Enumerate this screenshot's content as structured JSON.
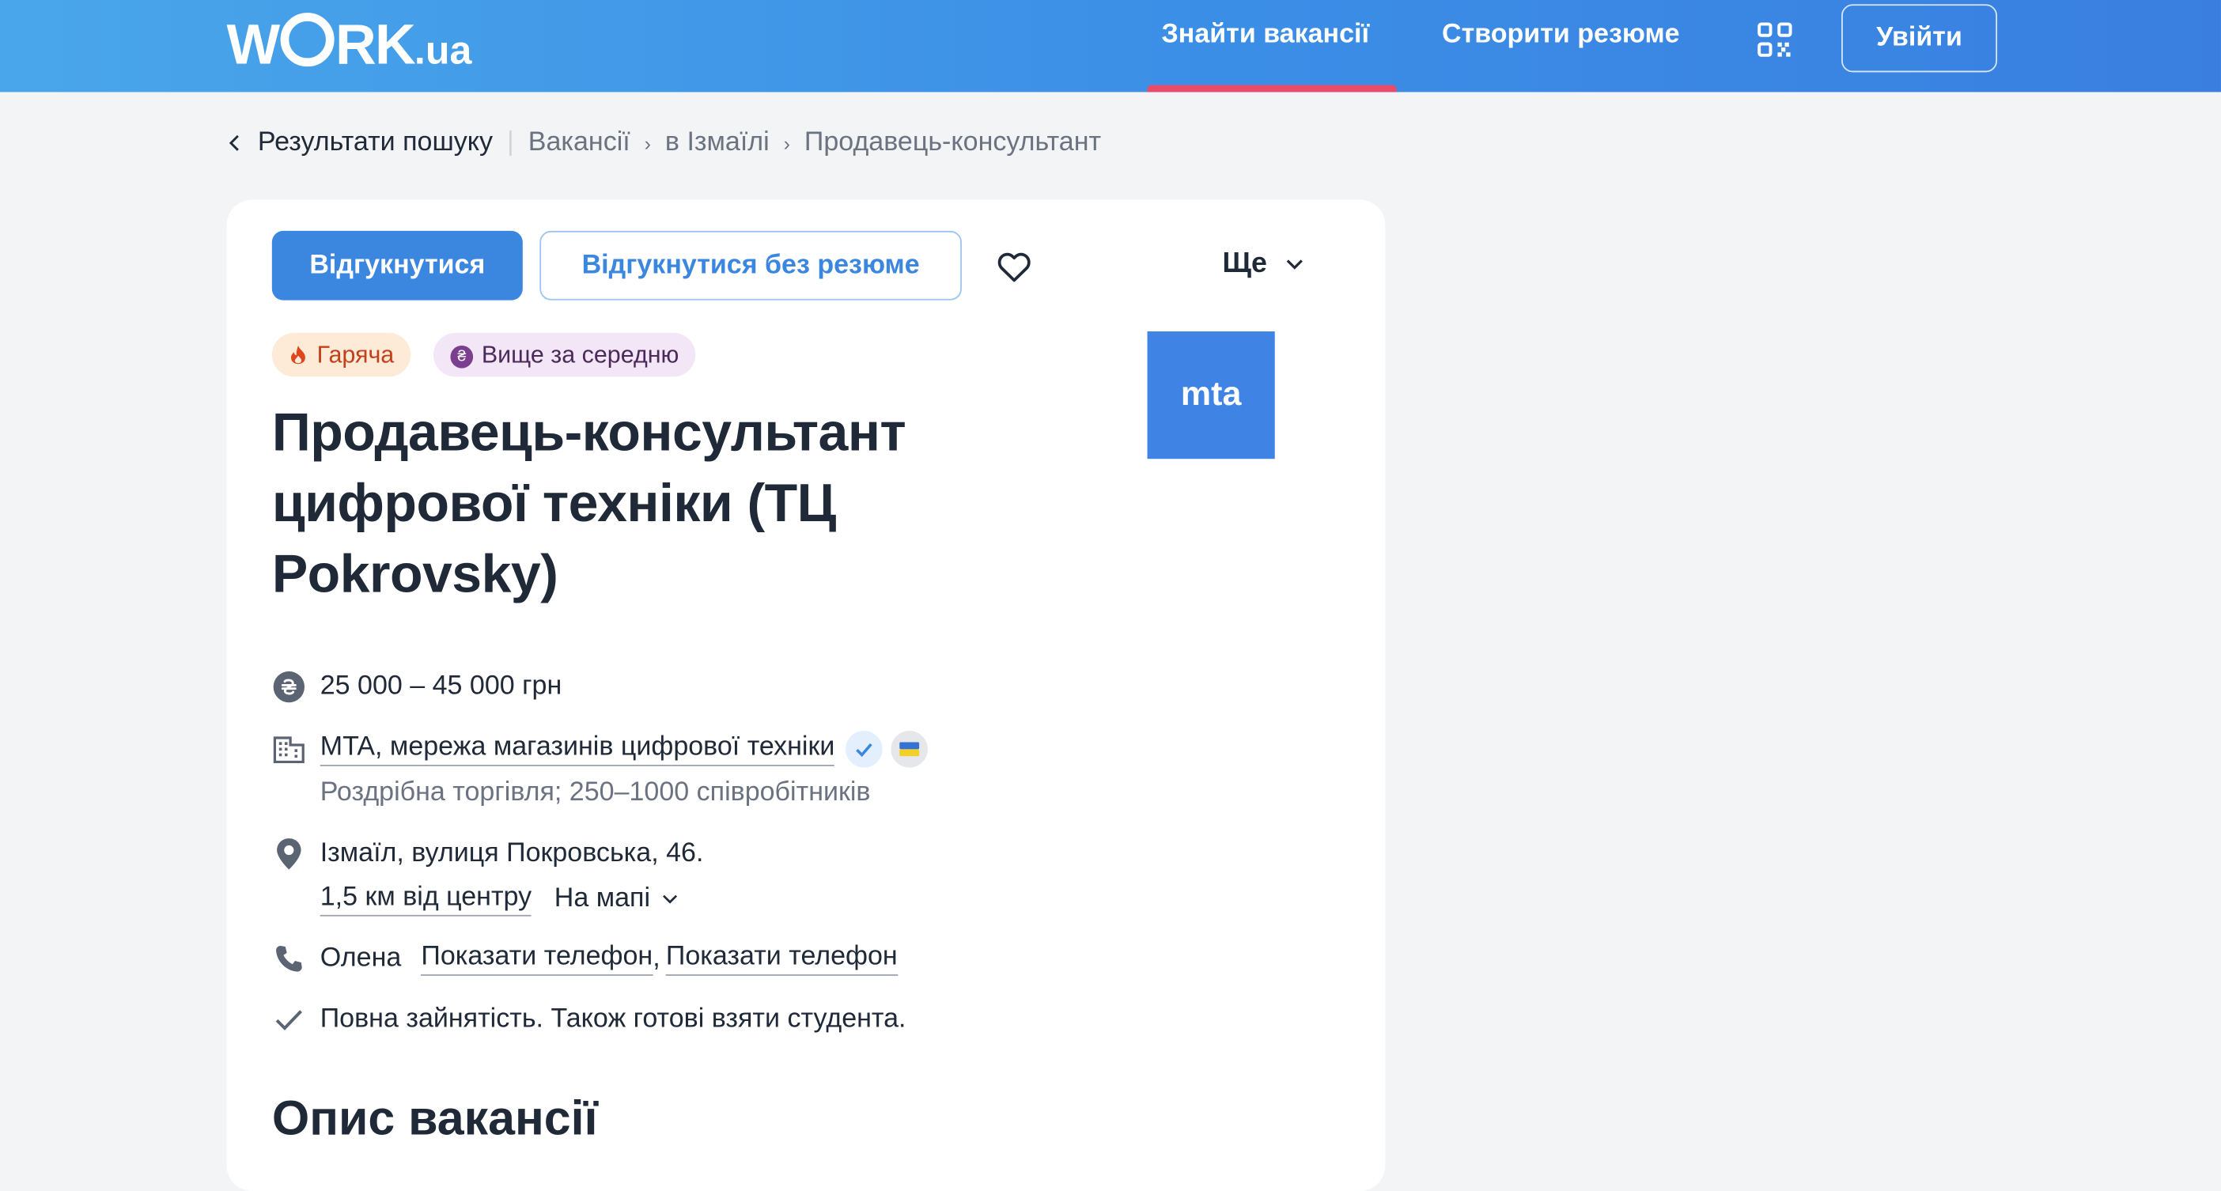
{
  "header": {
    "logo_main": "W",
    "logo_rest": "RK",
    "logo_suffix": ".ua",
    "nav_find": "Знайти вакансії",
    "nav_resume": "Створити резюме",
    "login": "Увійти"
  },
  "breadcrumb": {
    "back": "Результати пошуку",
    "items": [
      "Вакансії",
      "в Ізмаїлі",
      "Продавець-консультант"
    ]
  },
  "actions": {
    "apply": "Відгукнутися",
    "apply_no_resume": "Відгукнутися без резюме",
    "more": "Ще"
  },
  "tags": {
    "hot": "Гаряча",
    "salary_level": "Вище за середню",
    "salary_level_icon": "₴"
  },
  "vacancy": {
    "title": "Продавець-консультант цифрової техніки (ТЦ Pokrovsky)",
    "salary": "25 000 – 45 000 грн",
    "company": "MTA, мережа магазинів цифрової техніки",
    "company_meta": "Роздрібна торгівля; 250–1000 співробітників",
    "address": "Ізмаїл, вулиця Покровська, 46.",
    "distance": "1,5 км від центру",
    "map": "На мапі",
    "contact_name": "Олена",
    "show_phone_1": "Показати телефон",
    "show_phone_2": "Показати телефон",
    "employment": "Повна зайнятість. Також готові взяти студента.",
    "logo_text": "mta"
  },
  "description": {
    "heading": "Опис вакансії"
  },
  "colors": {
    "brand_blue": "#3b87e0",
    "nav_active": "#e94b6a",
    "hot_bg": "#fdebd8",
    "salary_tag_bg": "#f3e6f7"
  }
}
